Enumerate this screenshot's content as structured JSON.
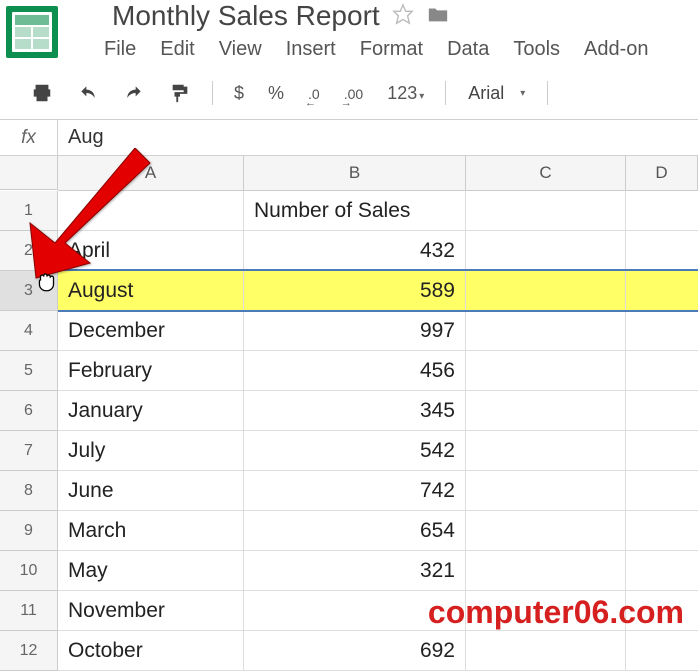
{
  "document": {
    "title": "Monthly Sales Report"
  },
  "menu": {
    "file": "File",
    "edit": "Edit",
    "view": "View",
    "insert": "Insert",
    "format": "Format",
    "data": "Data",
    "tools": "Tools",
    "addons": "Add-on"
  },
  "toolbar": {
    "currency": "$",
    "percent": "%",
    "dec_decrease": ".0",
    "dec_increase": ".00",
    "more_formats": "123",
    "font": "Arial"
  },
  "formula": {
    "fx": "fx",
    "value": "Aug"
  },
  "columns": [
    "A",
    "B",
    "C",
    "D"
  ],
  "rows": {
    "header_a": "",
    "header_b": "Number of Sales",
    "data": [
      {
        "num": "1",
        "a": "",
        "b": "Number of Sales"
      },
      {
        "num": "2",
        "a": "April",
        "b": "432"
      },
      {
        "num": "3",
        "a": "August",
        "b": "589",
        "highlighted": true
      },
      {
        "num": "4",
        "a": "December",
        "b": "997"
      },
      {
        "num": "5",
        "a": "February",
        "b": "456"
      },
      {
        "num": "6",
        "a": "January",
        "b": "345"
      },
      {
        "num": "7",
        "a": "July",
        "b": "542"
      },
      {
        "num": "8",
        "a": "June",
        "b": "742"
      },
      {
        "num": "9",
        "a": "March",
        "b": "654"
      },
      {
        "num": "10",
        "a": "May",
        "b": "321"
      },
      {
        "num": "11",
        "a": "November",
        "b": ""
      },
      {
        "num": "12",
        "a": "October",
        "b": "692"
      }
    ]
  },
  "watermark": "computer06.com"
}
